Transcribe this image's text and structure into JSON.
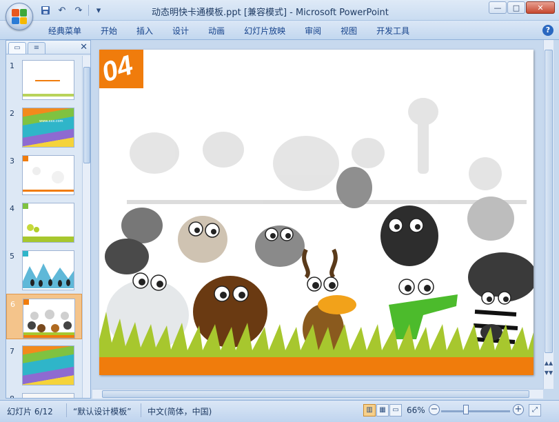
{
  "window": {
    "title": "动态明快卡通模板.ppt [兼容模式] - Microsoft PowerPoint",
    "controls": {
      "minimize": "—",
      "maximize": "□",
      "close": "✕"
    }
  },
  "quick_access": [
    {
      "name": "save-icon",
      "glyph": "▣"
    },
    {
      "name": "undo-icon",
      "glyph": "↶"
    },
    {
      "name": "redo-icon",
      "glyph": "↷"
    },
    {
      "name": "customize-qat-icon",
      "glyph": "▾"
    }
  ],
  "ribbon": {
    "tabs": [
      "经典菜单",
      "开始",
      "插入",
      "设计",
      "动画",
      "幻灯片放映",
      "审阅",
      "视图",
      "开发工具"
    ],
    "help": "?"
  },
  "slide_pane": {
    "close": "✕",
    "slides": [
      {
        "num": "1",
        "selected": false
      },
      {
        "num": "2",
        "selected": false
      },
      {
        "num": "3",
        "selected": false
      },
      {
        "num": "4",
        "selected": false
      },
      {
        "num": "5",
        "selected": false
      },
      {
        "num": "6",
        "selected": true
      },
      {
        "num": "7",
        "selected": false
      },
      {
        "num": "8",
        "selected": false
      }
    ],
    "thumb_caption": "www.xxx.com"
  },
  "slide": {
    "badge_text": "04",
    "colors": {
      "badge": "#f07c0c",
      "footer": "#f07c0c",
      "grass": "#a7c72e"
    }
  },
  "status": {
    "slide_info": "幻灯片 6/12",
    "template": "“默认设计模板”",
    "language": "中文(简体，中国)",
    "zoom": "66%",
    "zoom_minus": "−",
    "zoom_plus": "+"
  }
}
